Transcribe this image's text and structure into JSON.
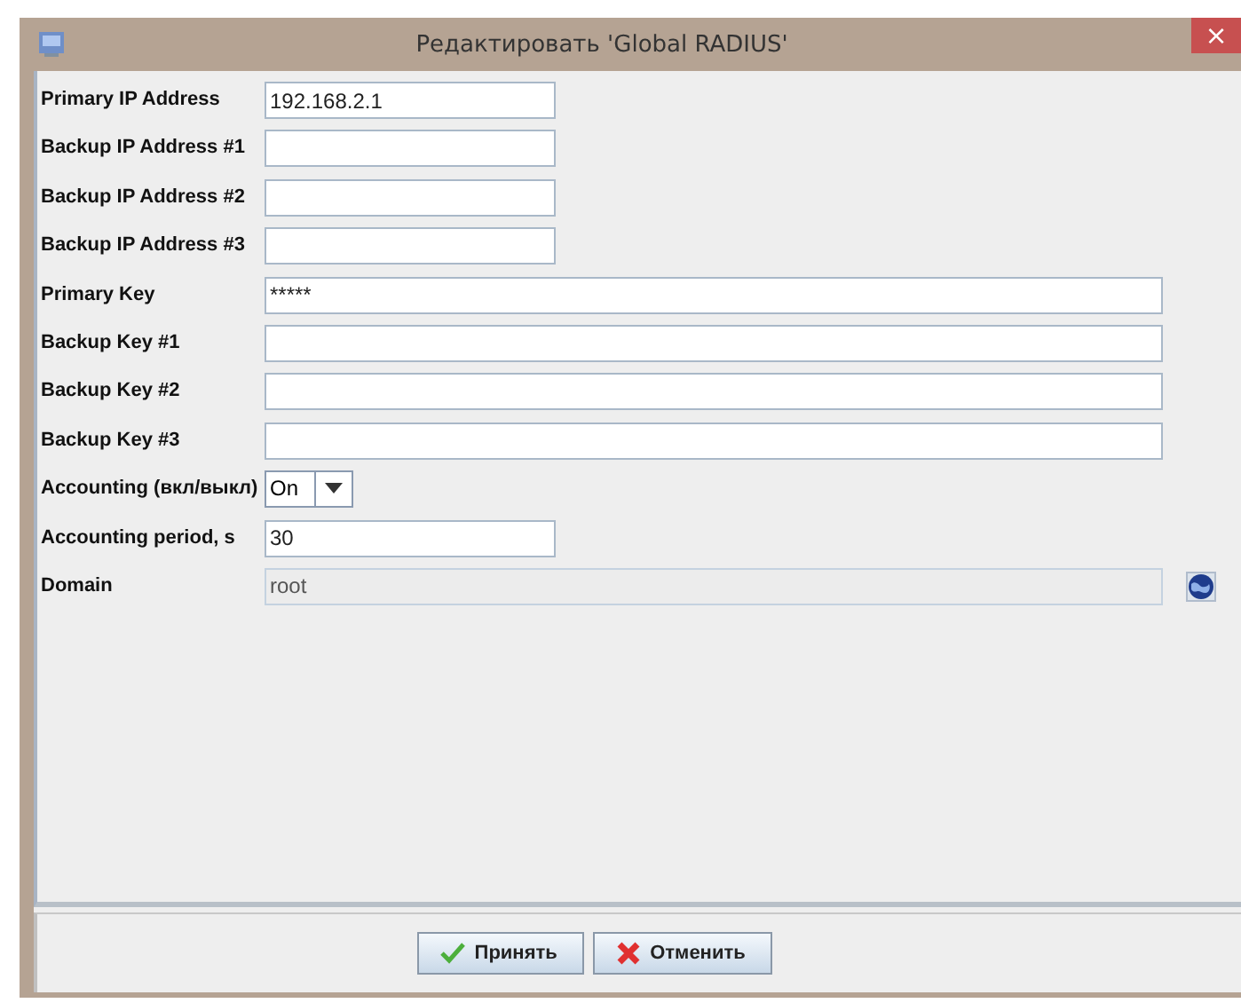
{
  "window": {
    "title": "Редактировать 'Global RADIUS'",
    "close": "×"
  },
  "fields": [
    {
      "label": "Primary IP Address",
      "kind": "text",
      "value": "192.168.2.1",
      "wide": false
    },
    {
      "label": "Backup IP Address #1",
      "kind": "text",
      "wide": false
    },
    {
      "label": "Backup IP Address #2",
      "kind": "text",
      "wide": false
    },
    {
      "label": "Backup IP Address #3",
      "kind": "text",
      "wide": false
    },
    {
      "label": "Primary Key",
      "kind": "text",
      "value": "*****",
      "wide": true
    },
    {
      "label": "Backup Key #1",
      "kind": "text",
      "wide": true
    },
    {
      "label": "Backup Key #2",
      "kind": "text",
      "wide": true
    },
    {
      "label": "Backup Key #3",
      "kind": "text",
      "wide": true
    },
    {
      "label": "Accounting (вкл/выкл)",
      "kind": "select",
      "value": "On"
    },
    {
      "label": "Accounting period, s",
      "kind": "text",
      "value": "30",
      "wide": false
    },
    {
      "label": "Domain",
      "kind": "readonly",
      "value": "root",
      "wide": true
    }
  ],
  "buttons": [
    {
      "label": "Принять",
      "kind": "ok"
    },
    {
      "label": "Отменить",
      "kind": "cancel"
    }
  ]
}
